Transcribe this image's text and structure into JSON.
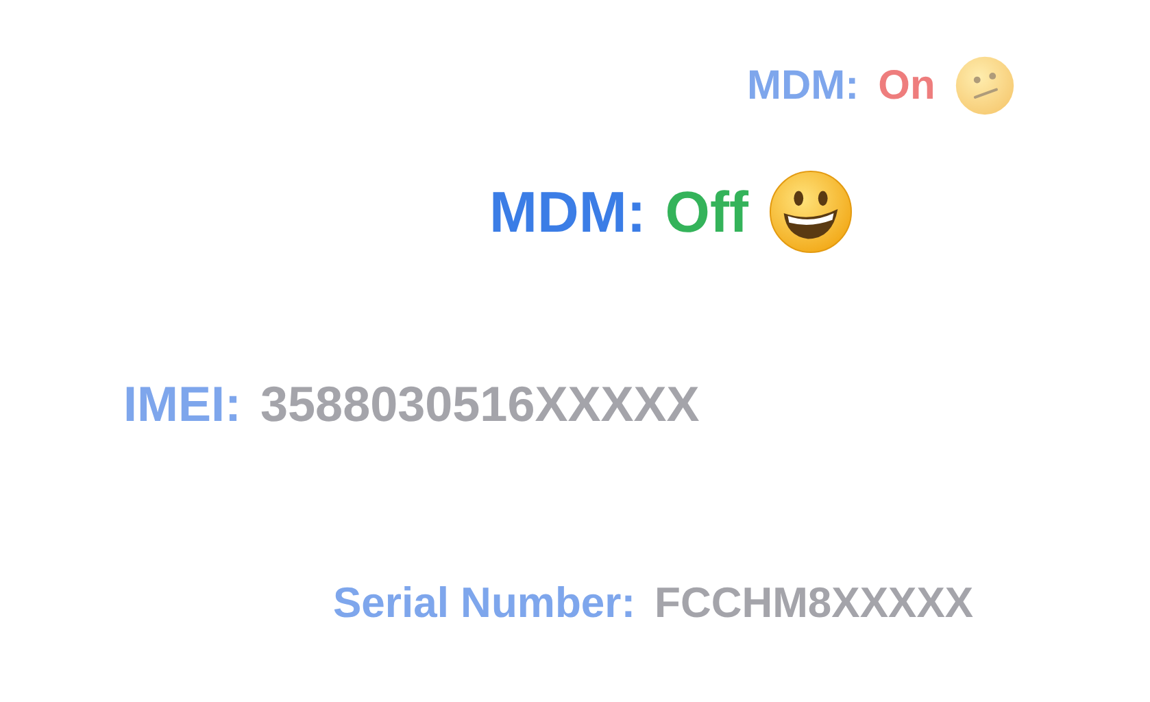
{
  "lines": [
    {
      "label": "MDM:",
      "value": "On",
      "kind": "on",
      "dimmed": true,
      "emoji": {
        "kind": "confused"
      }
    },
    {
      "label": "MDM:",
      "value": "Off",
      "kind": "off",
      "dimmed": false,
      "emoji": {
        "kind": "grinning"
      }
    },
    {
      "label": "IMEI:",
      "value": "3588030516XXXXX",
      "kind": "plain",
      "dimmed": true
    },
    {
      "label": "Serial Number:",
      "value": "FCCHM8XXXXX",
      "kind": "plain",
      "dimmed": true
    }
  ]
}
